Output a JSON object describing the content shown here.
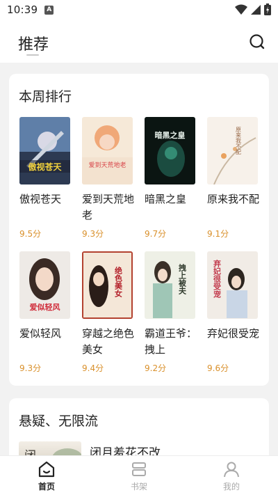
{
  "status_bar": {
    "time": "10:39",
    "notification_icon": "A"
  },
  "header": {
    "title": "推荐",
    "search_icon": "search-icon"
  },
  "weekly": {
    "title": "本周排行",
    "books": [
      {
        "title": "傲视苍天",
        "score": "9.5分",
        "cover_text": "傲视苍天"
      },
      {
        "title": "爱到天荒地老",
        "score": "9.3分",
        "cover_text": "爱到天荒地老"
      },
      {
        "title": "暗黑之皇",
        "score": "9.7分",
        "cover_text": "暗黑之皇"
      },
      {
        "title": "原来我不配",
        "score": "9.1分",
        "cover_text": "原来我不配"
      },
      {
        "title": "爱似轻风",
        "score": "9.3分",
        "cover_text": "爱似轻风"
      },
      {
        "title": "穿越之绝色美女",
        "score": "9.4分",
        "cover_text": "绝色美女"
      },
      {
        "title": "霸道王爷：拽上",
        "score": "9.2分",
        "cover_text": "拽上被夫"
      },
      {
        "title": "弃妃很受宠",
        "score": "9.6分",
        "cover_text": "弃妃很受宠"
      }
    ]
  },
  "suspense": {
    "title": "悬疑、无限流",
    "first_book": {
      "title": "闭月羞花不改",
      "cover_text": "闭"
    }
  },
  "bottom_nav": {
    "items": [
      {
        "label": "首页",
        "icon": "home-icon",
        "active": true
      },
      {
        "label": "书架",
        "icon": "bookshelf-icon",
        "active": false
      },
      {
        "label": "我的",
        "icon": "profile-icon",
        "active": false
      }
    ]
  },
  "colors": {
    "score": "#d9902b",
    "background": "#f2f2f2",
    "card": "#ffffff"
  }
}
